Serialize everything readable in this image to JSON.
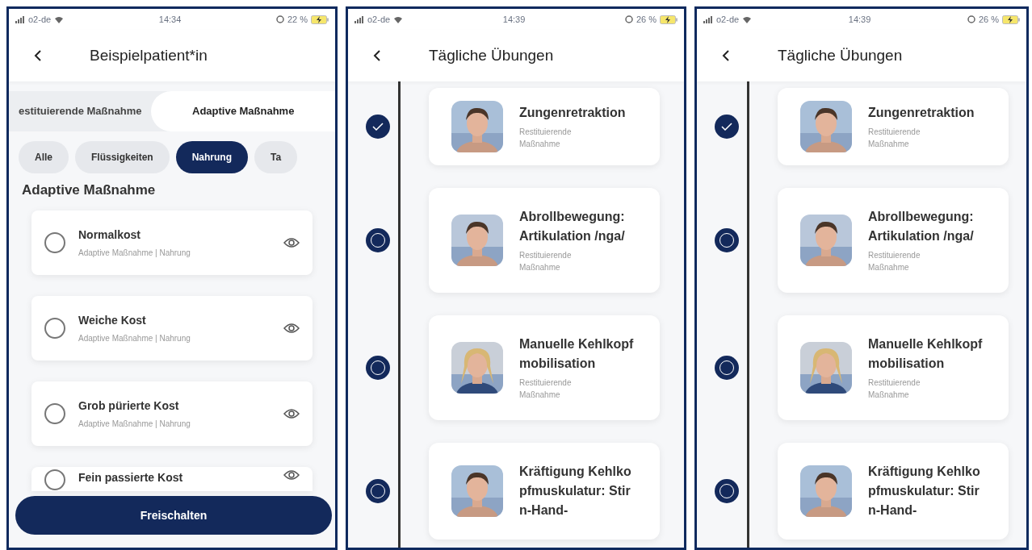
{
  "screens": [
    {
      "kind": "catalog",
      "status": {
        "carrier": "o2-de",
        "time": "14:34",
        "battery": "22 %"
      },
      "title": "Beispielpatient*in",
      "tabs": [
        {
          "label": "estituierende Maßnahme",
          "selected": false
        },
        {
          "label": "Adaptive Maßnahme",
          "selected": true
        }
      ],
      "chips": [
        {
          "label": "Alle",
          "selected": false
        },
        {
          "label": "Flüssigkeiten",
          "selected": false
        },
        {
          "label": "Nahrung",
          "selected": true
        },
        {
          "label": "Ta",
          "selected": false
        }
      ],
      "section": "Adaptive Maßnahme",
      "items": [
        {
          "title": "Normalkost",
          "subtitle": "Adaptive Maßnahme | Nahrung",
          "checked": false
        },
        {
          "title": "Weiche Kost",
          "subtitle": "Adaptive Maßnahme | Nahrung",
          "checked": false
        },
        {
          "title": "Grob pürierte Kost",
          "subtitle": "Adaptive Maßnahme | Nahrung",
          "checked": false
        },
        {
          "title": "Fein passierte Kost",
          "checked": false
        }
      ],
      "button": "Freischalten"
    },
    {
      "kind": "timeline",
      "status": {
        "carrier": "o2-de",
        "time": "14:39",
        "battery": "26 %"
      },
      "title": "Tägliche Übungen",
      "items": [
        {
          "title": "Zungenretraktion",
          "subtitle": "Restituierende Maßnahme",
          "done": true
        },
        {
          "title": "Abrollbewegung: Artikulation /nga/",
          "subtitle": "Restituierende Maßnahme",
          "done": false
        },
        {
          "title": "Manuelle Kehlkopfmobilisation",
          "subtitle": "Restituierende Maßnahme",
          "done": false
        },
        {
          "title": "Kräftigung Kehlkopfmuskulatur: Stirn-Hand-",
          "done": false
        }
      ]
    },
    {
      "kind": "timeline",
      "status": {
        "carrier": "o2-de",
        "time": "14:39",
        "battery": "26 %"
      },
      "title": "Tägliche Übungen",
      "items": [
        {
          "title": "Zungenretraktion",
          "subtitle": "Restituierende Maßnahme",
          "done": true
        },
        {
          "title": "Abrollbewegung: Artikulation /nga/",
          "subtitle": "Restituierende Maßnahme",
          "done": false
        },
        {
          "title": "Manuelle Kehlkopfmobilisation",
          "subtitle": "Restituierende Maßnahme",
          "done": false
        },
        {
          "title": "Kräftigung Kehlkopfmuskulatur: Stirn-Hand-",
          "done": false
        }
      ]
    }
  ]
}
